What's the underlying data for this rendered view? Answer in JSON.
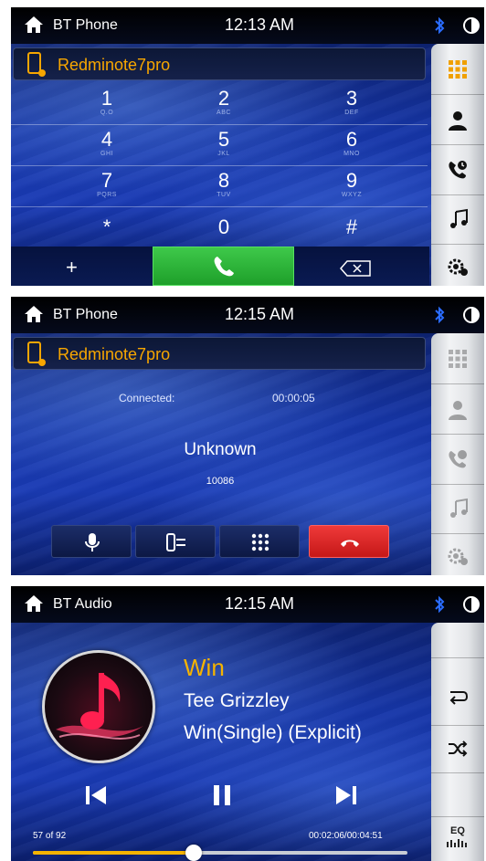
{
  "screen1": {
    "app_title": "BT Phone",
    "clock": "12:13 AM",
    "device_name": "Redminote7pro",
    "keypad": [
      {
        "num": "1",
        "letters": "Q.O"
      },
      {
        "num": "2",
        "letters": "ABC"
      },
      {
        "num": "3",
        "letters": "DEF"
      },
      {
        "num": "4",
        "letters": "GHI"
      },
      {
        "num": "5",
        "letters": "JKL"
      },
      {
        "num": "6",
        "letters": "MNO"
      },
      {
        "num": "7",
        "letters": "PQRS"
      },
      {
        "num": "8",
        "letters": "TUV"
      },
      {
        "num": "9",
        "letters": "WXYZ"
      },
      {
        "num": "*",
        "letters": ""
      },
      {
        "num": "0",
        "letters": ""
      },
      {
        "num": "#",
        "letters": ""
      }
    ],
    "plus_label": "+"
  },
  "screen2": {
    "app_title": "BT Phone",
    "clock": "12:15 AM",
    "device_name": "Redminote7pro",
    "status_label": "Connected:",
    "call_duration": "00:00:05",
    "caller_name": "Unknown",
    "caller_number": "10086"
  },
  "screen3": {
    "app_title": "BT Audio",
    "clock": "12:15 AM",
    "song_title": "Win",
    "artist": "Tee Grizzley",
    "album": "Win(Single) (Explicit)",
    "track_position": "57 of 92",
    "time_position": "00:02:06/00:04:51",
    "progress_fraction": 0.43,
    "eq_label": "EQ"
  },
  "colors": {
    "accent_orange": "#f7a600",
    "call_green": "#2ab336",
    "end_red": "#d82020",
    "bluetooth_blue": "#2a6cff"
  },
  "icons": {
    "home": "home-icon",
    "bluetooth": "bluetooth-icon",
    "brightness": "brightness-icon",
    "phone_device": "phone-device-icon",
    "keypad": "keypad-icon",
    "contacts": "contacts-icon",
    "recent_calls": "recent-calls-icon",
    "bt_music": "music-icon",
    "settings": "settings-icon",
    "call": "call-icon",
    "backspace": "backspace-icon",
    "microphone": "microphone-icon",
    "transfer": "audio-transfer-icon",
    "end_call": "end-call-icon",
    "repeat": "repeat-icon",
    "shuffle": "shuffle-icon",
    "previous": "previous-track-icon",
    "pause": "pause-icon",
    "next": "next-track-icon",
    "equalizer": "equalizer-icon"
  }
}
